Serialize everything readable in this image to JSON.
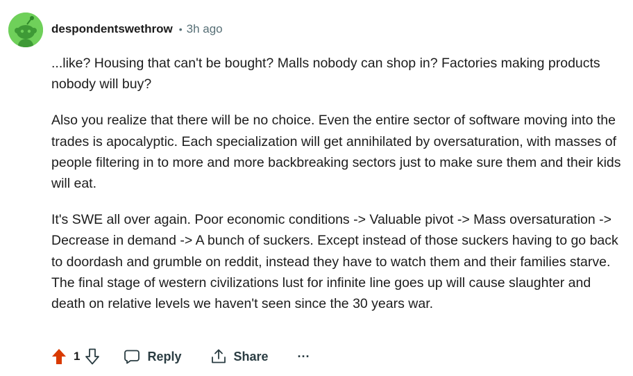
{
  "comment": {
    "author": "despondentswethrow",
    "separator": "•",
    "time": "3h ago",
    "paragraphs": [
      "...like? Housing that can't be bought? Malls nobody can shop in? Factories making products nobody will buy?",
      "Also you realize that there will be no choice. Even the entire sector of software moving into the trades is apocalyptic. Each specialization will get annihilated by oversaturation, with masses of people filtering in to more and more backbreaking sectors just to make sure them and their kids will eat.",
      "It's SWE all over again. Poor economic conditions -> Valuable pivot -> Mass oversaturation -> Decrease in demand -> A bunch of suckers. Except instead of those suckers having to go back to doordash and grumble on reddit, instead they have to watch them and their families starve. The final stage of western civilizations lust for infinite line goes up will cause slaughter and death on relative levels we haven't seen since the 30 years war."
    ]
  },
  "actions": {
    "score": "1",
    "reply_label": "Reply",
    "share_label": "Share",
    "more_label": "···"
  },
  "icons": {
    "avatar": "snoo-avatar-icon",
    "upvote": "upvote-arrow-icon",
    "downvote": "downvote-arrow-icon",
    "reply": "speech-bubble-icon",
    "share": "share-icon"
  },
  "colors": {
    "upvote_active": "#d93a00",
    "avatar_bg": "#6fd05a",
    "meta_text": "#576f76",
    "text": "#1c1c1c"
  }
}
